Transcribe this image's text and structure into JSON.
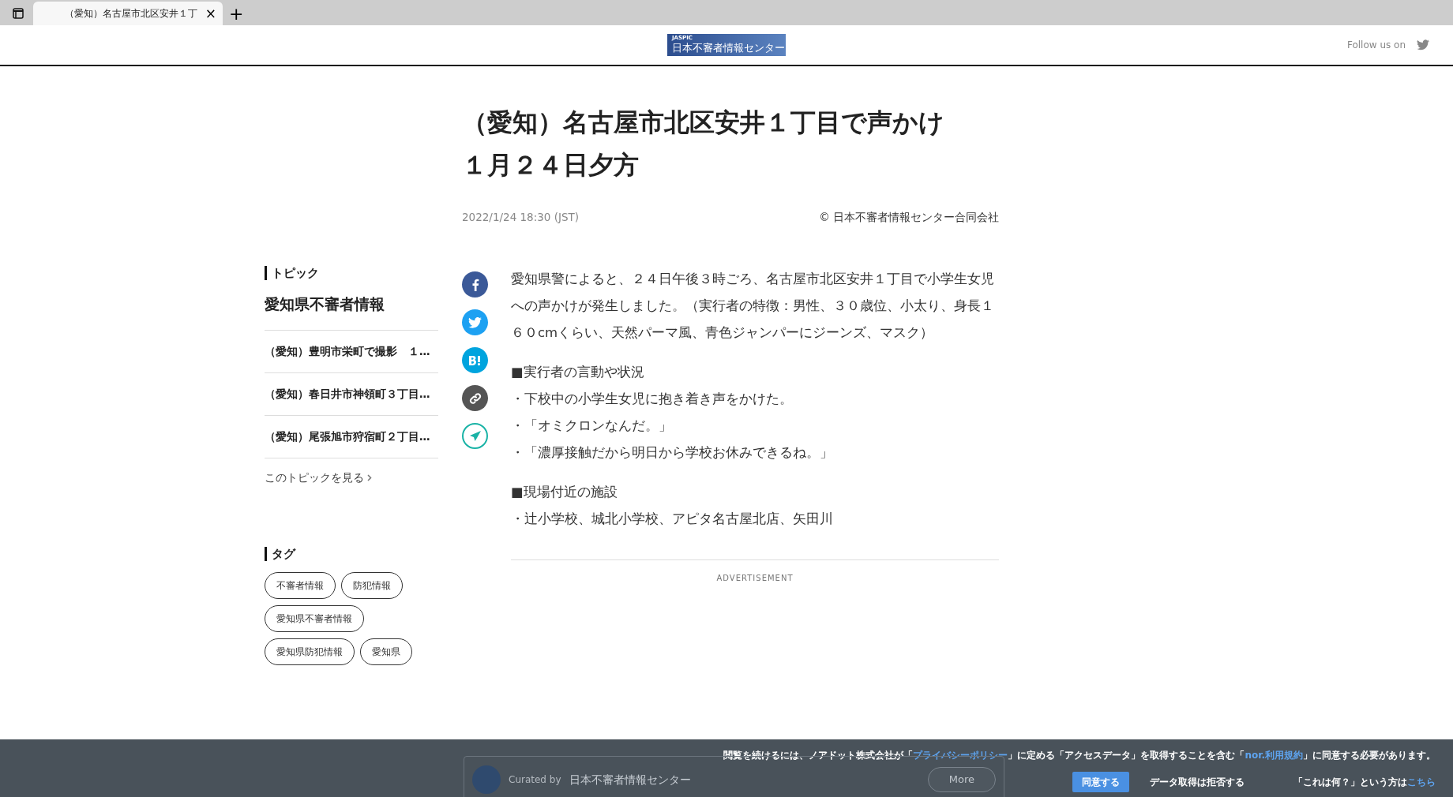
{
  "browser": {
    "tab_title": "（愛知）名古屋市北区安井１丁",
    "close": "×",
    "new_tab": "+"
  },
  "header": {
    "logo_small": "JASPIC",
    "logo_main": "日本不審者情報センター",
    "follow": "Follow us on"
  },
  "article": {
    "title_lines": [
      "（愛知）名古屋市北区安井１丁目で声かけ",
      "１月２４日夕方"
    ],
    "date": "2022/1/24 18:30 (JST)",
    "copyright": "© 日本不審者情報センター合同会社",
    "blocks": [
      {
        "kind": "paragraph",
        "text": "愛知県警によると、２４日午後３時ごろ、名古屋市北区安井１丁目で小学生女児への声かけが発生しました。（実行者の特徴：男性、３０歳位、小太り、身長１６０cmくらい、天然パーマ風、青色ジャンパーにジーンズ、マスク）"
      },
      {
        "kind": "heading",
        "text": "■実行者の言動や状況"
      },
      {
        "kind": "line",
        "text": "・下校中の小学生女児に抱き着き声をかけた。"
      },
      {
        "kind": "line",
        "text": "・「オミクロンなんだ。」"
      },
      {
        "kind": "line",
        "text": "・「濃厚接触だから明日から学校お休みできるね。」"
      },
      {
        "kind": "heading",
        "text": "■現場付近の施設"
      },
      {
        "kind": "line",
        "text": "・辻小学校、城北小学校、アピタ名古屋北店、矢田川"
      }
    ],
    "ad_label": "ADVERTISEMENT",
    "share": [
      {
        "kind": "facebook"
      },
      {
        "kind": "twitter"
      },
      {
        "kind": "hatena"
      },
      {
        "kind": "link"
      },
      {
        "kind": "send"
      }
    ]
  },
  "sidebar": {
    "topic_label": "トピック",
    "topic_title": "愛知県不審者情報",
    "topic_items": [
      "（愛知）豊明市栄町で撮影　１…",
      "（愛知）春日井市神領町３丁目…",
      "（愛知）尾張旭市狩宿町２丁目…"
    ],
    "topic_more": "このトピックを見る",
    "tag_label": "タグ",
    "tags": [
      "不審者情報",
      "防犯情報",
      "愛知県不審者情報",
      "愛知県防犯情報",
      "愛知県"
    ]
  },
  "curated": {
    "label": "Curated by",
    "name": "日本不審者情報センター",
    "more": "More"
  },
  "consent": {
    "message_parts": [
      {
        "kind": "text",
        "text": "閲覧を続けるには、ノアドット株式会社が「"
      },
      {
        "kind": "link",
        "text": "プライバシーポリシー"
      },
      {
        "kind": "text",
        "text": "」に定める「アクセスデータ」を取得することを含む「"
      },
      {
        "kind": "link",
        "text": "nor.利用規約"
      },
      {
        "kind": "text",
        "text": "」に同意する必要があります。"
      }
    ],
    "agree": "同意する",
    "refuse": "データ取得は拒否する",
    "what_text": "「これは何？」という方は",
    "what_link": "こちら"
  }
}
